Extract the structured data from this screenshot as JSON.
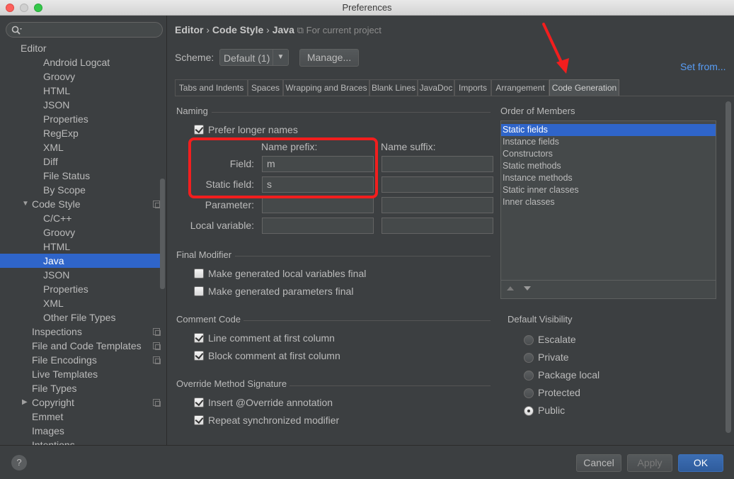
{
  "window": {
    "title": "Preferences"
  },
  "sidebar": {
    "search_placeholder": "",
    "section": "Editor",
    "items": [
      {
        "label": "Android Logcat"
      },
      {
        "label": "Groovy"
      },
      {
        "label": "HTML"
      },
      {
        "label": "JSON"
      },
      {
        "label": "Properties"
      },
      {
        "label": "RegExp"
      },
      {
        "label": "XML"
      },
      {
        "label": "Diff"
      },
      {
        "label": "File Status"
      },
      {
        "label": "By Scope"
      },
      {
        "label": "Code Style"
      },
      {
        "label": "C/C++"
      },
      {
        "label": "Groovy"
      },
      {
        "label": "HTML"
      },
      {
        "label": "Java"
      },
      {
        "label": "JSON"
      },
      {
        "label": "Properties"
      },
      {
        "label": "XML"
      },
      {
        "label": "Other File Types"
      },
      {
        "label": "Inspections"
      },
      {
        "label": "File and Code Templates"
      },
      {
        "label": "File Encodings"
      },
      {
        "label": "Live Templates"
      },
      {
        "label": "File Types"
      },
      {
        "label": "Copyright"
      },
      {
        "label": "Emmet"
      },
      {
        "label": "Images"
      },
      {
        "label": "Intentions"
      }
    ]
  },
  "breadcrumb": {
    "part1": "Editor",
    "part2": "Code Style",
    "part3": "Java",
    "project_note": "For current project"
  },
  "scheme": {
    "label": "Scheme:",
    "value": "Default (1)",
    "manage_label": "Manage...",
    "set_from": "Set from..."
  },
  "tabs": [
    {
      "label": "Tabs and Indents"
    },
    {
      "label": "Spaces"
    },
    {
      "label": "Wrapping and Braces"
    },
    {
      "label": "Blank Lines"
    },
    {
      "label": "JavaDoc"
    },
    {
      "label": "Imports"
    },
    {
      "label": "Arrangement"
    },
    {
      "label": "Code Generation"
    }
  ],
  "naming": {
    "title": "Naming",
    "prefer_longer": "Prefer longer names",
    "prefix_header": "Name prefix:",
    "suffix_header": "Name suffix:",
    "rows": [
      {
        "label": "Field:",
        "prefix": "m",
        "suffix": ""
      },
      {
        "label": "Static field:",
        "prefix": "s",
        "suffix": ""
      },
      {
        "label": "Parameter:",
        "prefix": "",
        "suffix": ""
      },
      {
        "label": "Local variable:",
        "prefix": "",
        "suffix": ""
      }
    ]
  },
  "final_modifier": {
    "title": "Final Modifier",
    "local_vars": "Make generated local variables final",
    "params": "Make generated parameters final"
  },
  "comment_code": {
    "title": "Comment Code",
    "line_comment": "Line comment at first column",
    "block_comment": "Block comment at first column"
  },
  "override": {
    "title": "Override Method Signature",
    "insert_override": "Insert @Override annotation",
    "repeat_sync": "Repeat synchronized modifier"
  },
  "order_of_members": {
    "title": "Order of Members",
    "items": [
      "Static fields",
      "Instance fields",
      "Constructors",
      "Static methods",
      "Instance methods",
      "Static inner classes",
      "Inner classes"
    ]
  },
  "default_visibility": {
    "title": "Default Visibility",
    "options": [
      "Escalate",
      "Private",
      "Package local",
      "Protected",
      "Public"
    ],
    "selected": "Public"
  },
  "footer": {
    "help": "?",
    "cancel": "Cancel",
    "apply": "Apply",
    "ok": "OK"
  },
  "colors": {
    "selection": "#2f65ca",
    "highlight_box": "#f21e1e",
    "link": "#589df6"
  },
  "icons": {
    "search": "search-icon",
    "copy": "copy-icon",
    "help": "help-icon",
    "arrow": "annotation-arrow"
  }
}
